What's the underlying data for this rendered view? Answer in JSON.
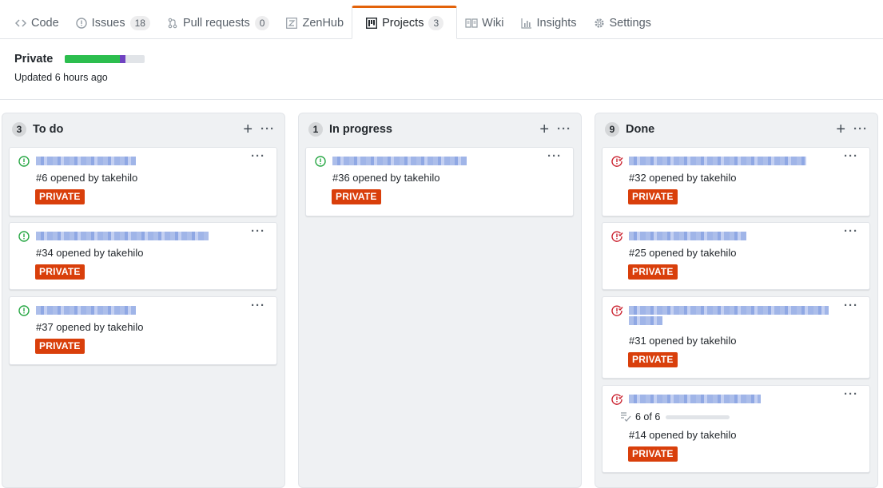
{
  "tabs": [
    {
      "label": "Code",
      "icon": "code-icon",
      "count": null
    },
    {
      "label": "Issues",
      "icon": "issue-icon",
      "count": "18"
    },
    {
      "label": "Pull requests",
      "icon": "pull-request-icon",
      "count": "0"
    },
    {
      "label": "ZenHub",
      "icon": "zenhub-icon",
      "count": null
    },
    {
      "label": "Projects",
      "icon": "project-icon",
      "count": "3",
      "selected": true
    },
    {
      "label": "Wiki",
      "icon": "book-icon",
      "count": null
    },
    {
      "label": "Insights",
      "icon": "graph-icon",
      "count": null
    },
    {
      "label": "Settings",
      "icon": "gear-icon",
      "count": null
    }
  ],
  "project": {
    "name": "Private",
    "updated": "Updated 6 hours ago",
    "progress": {
      "done": 0.69,
      "in_progress": 0.07
    }
  },
  "columns": [
    {
      "count": "3",
      "name": "To do",
      "cards": [
        {
          "status": "open",
          "meta": "#6 opened by takehilo",
          "label": "PRIVATE"
        },
        {
          "status": "open",
          "meta": "#34 opened by takehilo",
          "label": "PRIVATE"
        },
        {
          "status": "open",
          "meta": "#37 opened by takehilo",
          "label": "PRIVATE"
        }
      ]
    },
    {
      "count": "1",
      "name": "In progress",
      "cards": [
        {
          "status": "open",
          "meta": "#36 opened by takehilo",
          "label": "PRIVATE"
        }
      ]
    },
    {
      "count": "9",
      "name": "Done",
      "cards": [
        {
          "status": "closed",
          "meta": "#32 opened by takehilo",
          "label": "PRIVATE"
        },
        {
          "status": "closed",
          "meta": "#25 opened by takehilo",
          "label": "PRIVATE"
        },
        {
          "status": "closed",
          "meta": "#31 opened by takehilo",
          "label": "PRIVATE"
        },
        {
          "status": "closed",
          "meta": "#14 opened by takehilo",
          "label": "PRIVATE",
          "tasks": "6 of 6"
        }
      ]
    }
  ],
  "colors": {
    "open": "#28a745",
    "closed": "#cb2431",
    "label": "#d93f0b",
    "accent": "#e36209"
  }
}
